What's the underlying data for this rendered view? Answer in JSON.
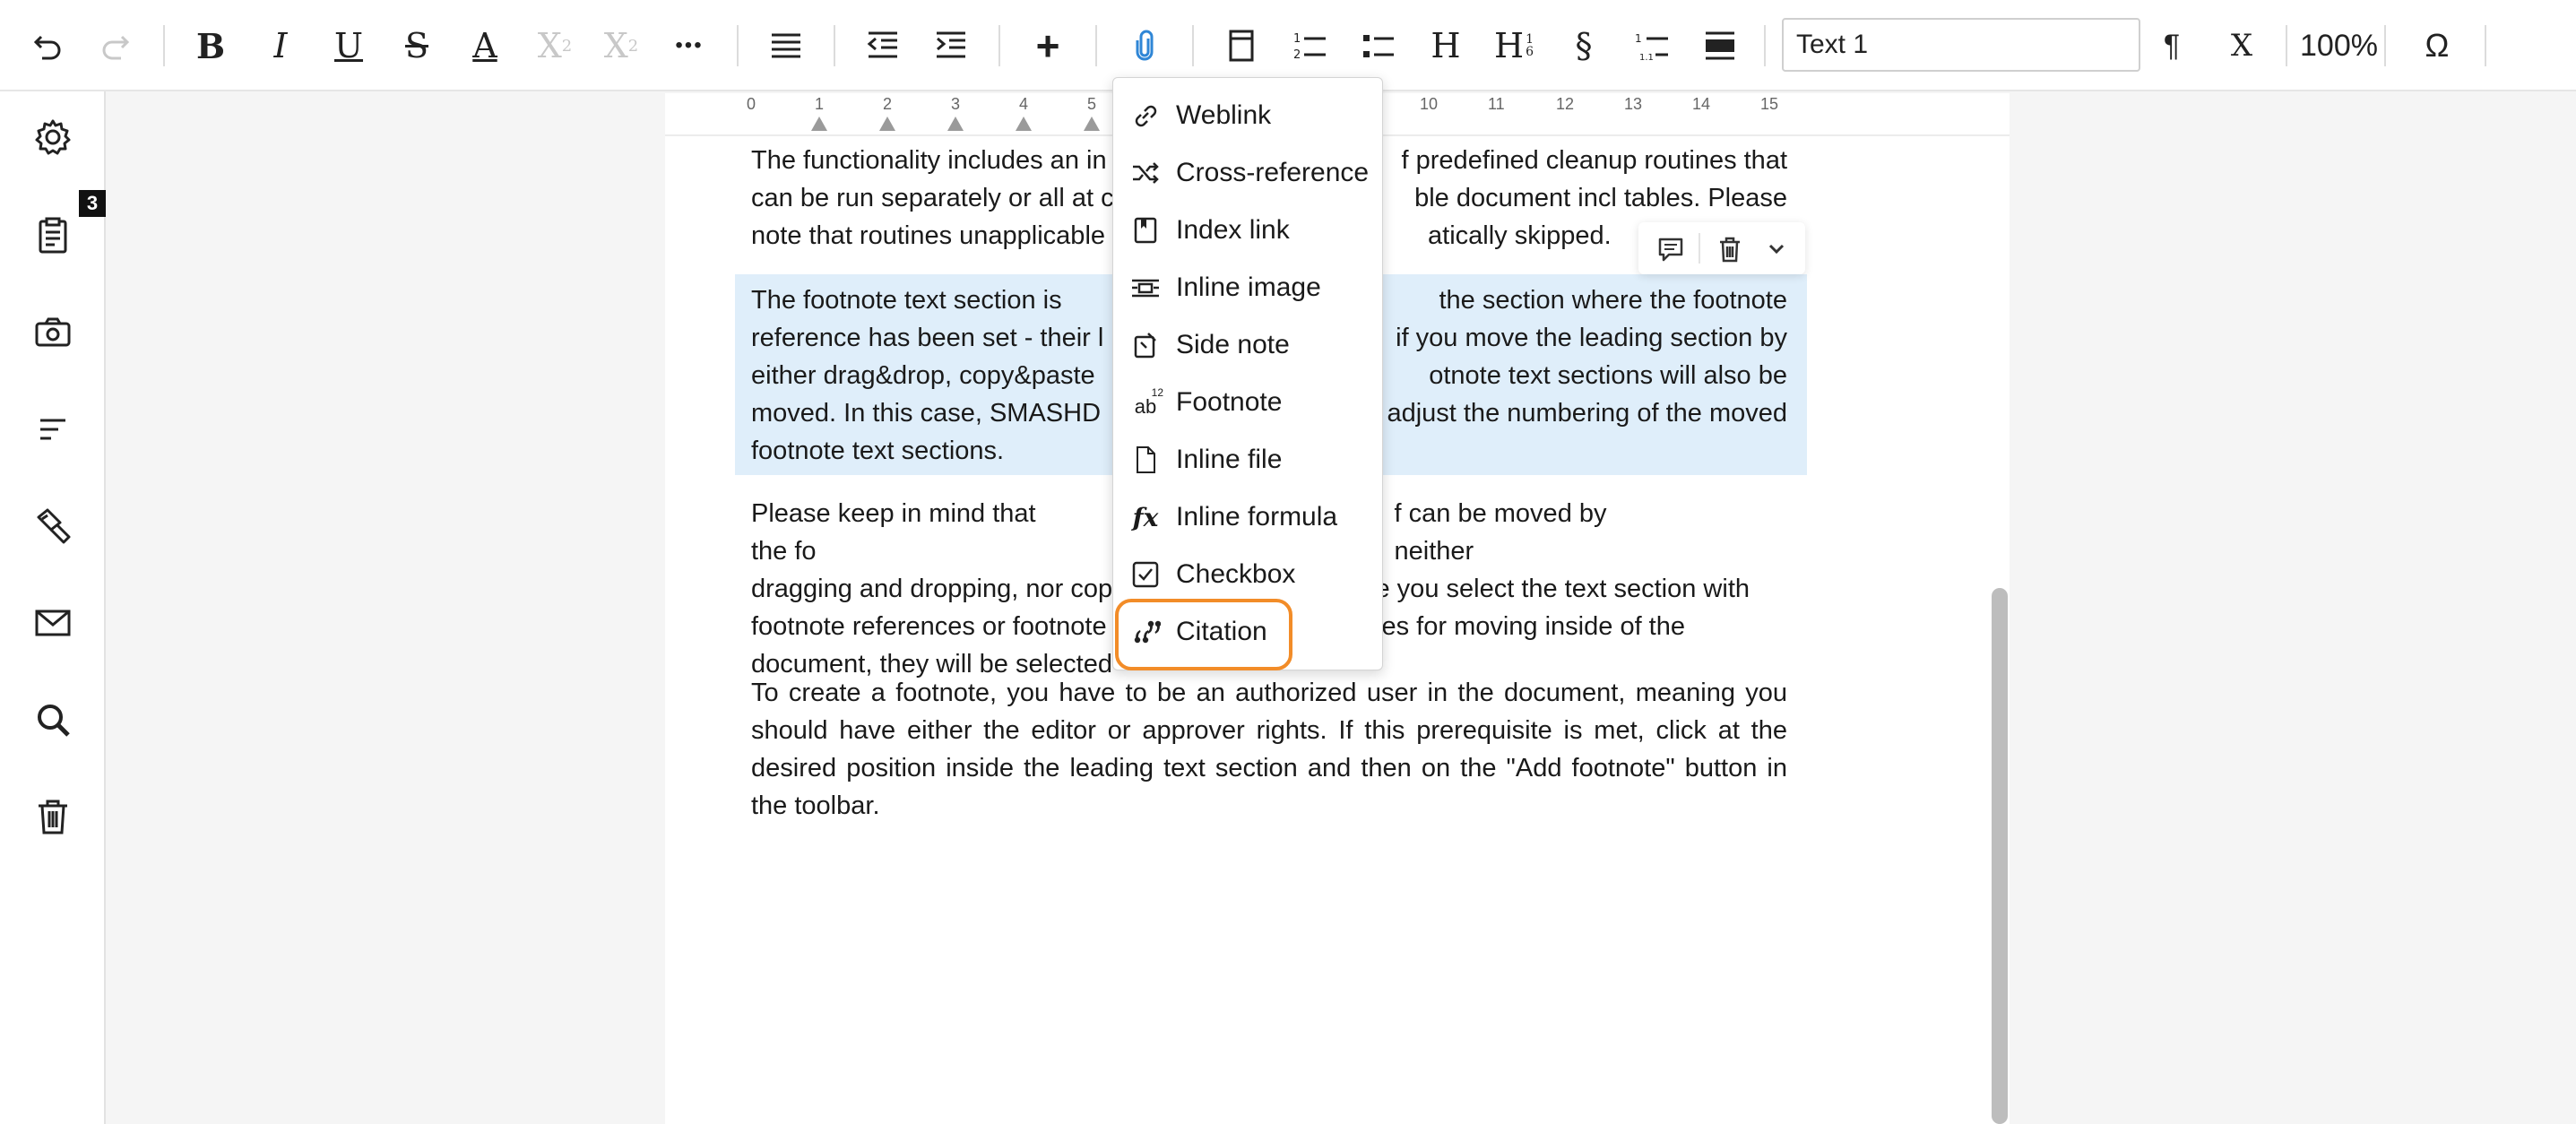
{
  "toolbar": {
    "bold": "B",
    "italic": "I",
    "underline": "U",
    "strike": "S",
    "font_color": "A",
    "superscript": "X",
    "superscript_mark": "2",
    "subscript": "X",
    "subscript_mark": "2",
    "more": "•••",
    "add": "+",
    "heading": "H",
    "heading_numbered": "H",
    "heading_numbered_mark": "1",
    "heading_numbered_mark2": "6",
    "section_sign": "§",
    "style_value": "Text 1",
    "pilcrow": "¶",
    "clear_format": "X",
    "zoom": "100%",
    "special_char": "Ω"
  },
  "sidebar": {
    "badge": "3"
  },
  "ruler": {
    "numbers": [
      "0",
      "1",
      "2",
      "3",
      "4",
      "5",
      "10",
      "11",
      "12",
      "13",
      "14",
      "15"
    ]
  },
  "document": {
    "para1": "The functionality includes an in… f predefined cleanup routines that can be run separately or all at c… ble document incl tables. Please note that routines unapplicable … atically skipped.",
    "para1_lines": [
      "The functionality includes an in",
      "f predefined cleanup routines that",
      "can be run separately or all at c",
      "ble document incl tables. Please",
      "note that routines unapplicable",
      "atically skipped."
    ],
    "para2_lines": [
      [
        "The footnote text section is",
        "the section where the footnote"
      ],
      [
        "reference has been set - their l",
        "if you move the leading section by"
      ],
      [
        "either drag&drop, copy&paste",
        "otnote text sections will also be"
      ],
      [
        "moved. In this case, SMASHD",
        "adjust the numbering of the moved"
      ],
      [
        "footnote text sections.",
        ""
      ]
    ],
    "para3_lines": [
      [
        "Please keep in mind that the fo",
        "f can be moved by neither"
      ],
      [
        "dragging and dropping, nor cop",
        "e you select the text section with"
      ],
      [
        "footnote references or footnote",
        "es for moving inside of the"
      ],
      [
        "document, they will be selected",
        ""
      ]
    ],
    "para4": "To create a footnote, you have to be an authorized user in the document, meaning you should have either the editor or approver rights. If this prerequisite is met, click at the desired position inside the leading text section and then on the \"Add footnote\" button in the toolbar."
  },
  "insert_menu": {
    "items": [
      {
        "label": "Weblink",
        "icon": "link-icon"
      },
      {
        "label": "Cross-reference",
        "icon": "cross-reference-icon"
      },
      {
        "label": "Index link",
        "icon": "index-link-icon"
      },
      {
        "label": "Inline image",
        "icon": "inline-image-icon"
      },
      {
        "label": "Side note",
        "icon": "side-note-icon"
      },
      {
        "label": "Footnote",
        "icon": "footnote-icon"
      },
      {
        "label": "Inline file",
        "icon": "file-icon"
      },
      {
        "label": "Inline formula",
        "icon": "formula-icon"
      },
      {
        "label": "Checkbox",
        "icon": "checkbox-icon"
      },
      {
        "label": "Citation",
        "icon": "quote-icon"
      }
    ],
    "highlighted": "Citation",
    "footnote_icon_text": "ab",
    "footnote_icon_mark": "12",
    "formula_icon_text": "fx"
  },
  "colors": {
    "accent": "#2f86d6",
    "highlight_ring": "#f28c28",
    "selection": "#dfeefa"
  }
}
